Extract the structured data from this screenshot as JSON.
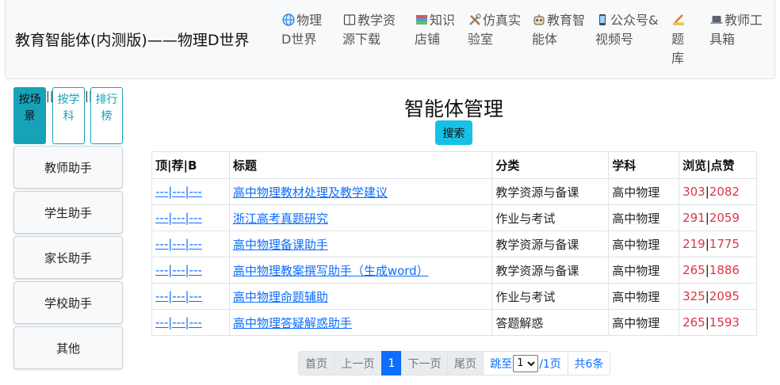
{
  "brand": "教育智能体(内测版)——物理D世界",
  "nav": [
    {
      "icon": "globe-icon",
      "label": "物理D世界"
    },
    {
      "icon": "book-icon",
      "label": "教学资源下载"
    },
    {
      "icon": "books-icon",
      "label": "知识店铺"
    },
    {
      "icon": "tools-icon",
      "label": "仿真实验室"
    },
    {
      "icon": "robot-icon",
      "label": "教育智能体"
    },
    {
      "icon": "phone-icon",
      "label": "公众号&视频号"
    },
    {
      "icon": "pencil-icon",
      "label": "题库"
    },
    {
      "icon": "laptop-icon",
      "label": "教师工具箱"
    }
  ],
  "view_buttons": [
    {
      "label": "按场景",
      "active": true
    },
    {
      "label": "按学科",
      "active": false
    },
    {
      "label": "排行榜",
      "active": false
    }
  ],
  "separator": "||",
  "side_buttons": [
    "教师助手",
    "学生助手",
    "家长助手",
    "学校助手",
    "其他"
  ],
  "page_title": "智能体管理",
  "search_label": "搜索",
  "table": {
    "headers": [
      "顶|荐|B",
      "标题",
      "分类",
      "学科",
      "浏览|点赞"
    ],
    "rows": [
      {
        "actions": "---|---|---",
        "title": "高中物理教材处理及教学建议",
        "category": "教学资源与备课",
        "subject": "高中物理",
        "views": "303",
        "likes": "2082"
      },
      {
        "actions": "---|---|---",
        "title": "浙江高考真题研究",
        "category": "作业与考试",
        "subject": "高中物理",
        "views": "291",
        "likes": "2059"
      },
      {
        "actions": "---|---|---",
        "title": "高中物理备课助手",
        "category": "教学资源与备课",
        "subject": "高中物理",
        "views": "219",
        "likes": "1775"
      },
      {
        "actions": "---|---|---",
        "title": "高中物理教案撰写助手（生成word）",
        "category": "教学资源与备课",
        "subject": "高中物理",
        "views": "265",
        "likes": "1886"
      },
      {
        "actions": "---|---|---",
        "title": "高中物理命题辅助",
        "category": "作业与考试",
        "subject": "高中物理",
        "views": "325",
        "likes": "2095"
      },
      {
        "actions": "---|---|---",
        "title": "高中物理答疑解惑助手",
        "category": "答题解惑",
        "subject": "高中物理",
        "views": "265",
        "likes": "1593"
      }
    ]
  },
  "pagination": {
    "first": "首页",
    "prev": "上一页",
    "current": "1",
    "next": "下一页",
    "last": "尾页",
    "jump_prefix": "跳至",
    "jump_value": "1",
    "jump_suffix": "/1页",
    "total": "共6条"
  },
  "colors": {
    "accent": "#17a2b8",
    "search": "#17c1e6",
    "link": "#0d6efd",
    "stats": "#dc3545"
  }
}
